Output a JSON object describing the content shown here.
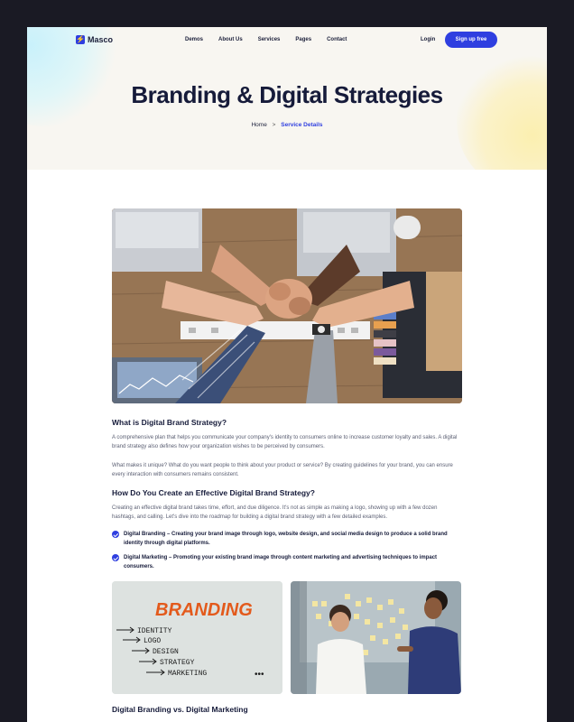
{
  "brand": {
    "name": "Masco",
    "logo_glyph": "⚡",
    "accent": "#2f3fe0"
  },
  "nav": {
    "items": [
      "Demos",
      "About Us",
      "Services",
      "Pages",
      "Contact"
    ],
    "login": "Login",
    "signup": "Sign up free"
  },
  "hero": {
    "title": "Branding & Digital Strategies",
    "breadcrumb": {
      "home": "Home",
      "separator": ">",
      "current": "Service Details"
    }
  },
  "article": {
    "section1": {
      "heading": "What is Digital Brand Strategy?",
      "p1": "A comprehensive plan that helps you communicate your company's identity to consumers online to increase customer loyalty and sales. A digital brand strategy also defines how your organization wishes to be perceived by consumers.",
      "p2": "What makes it unique? What do you want people to think about your product or service? By creating guidelines for your brand, you can ensure every interaction with consumers remains consistent."
    },
    "section2": {
      "heading": "How Do You Create an Effective Digital Brand Strategy?",
      "p1": "Creating an effective digital brand takes time, effort, and due diligence. It's not as simple as making a logo, showing up with a few dozen hashtags, and calling. Let's dive into the roadmap for building a digital brand strategy with a few detailed examples.",
      "bullets": [
        "Digital Branding – Creating your brand image through logo, website design, and social media design to produce a solid brand identity through digital platforms.",
        "Digital Marketing – Promoting your existing brand image through content marketing and advertising techniques to impact consumers."
      ]
    },
    "whiteboard": {
      "title": "BRANDING",
      "items": [
        "IDENTITY",
        "LOGO",
        "DESIGN",
        "STRATEGY",
        "MARKETING"
      ],
      "dots": "•••"
    },
    "section3": {
      "heading": "Digital Branding vs. Digital Marketing"
    }
  }
}
